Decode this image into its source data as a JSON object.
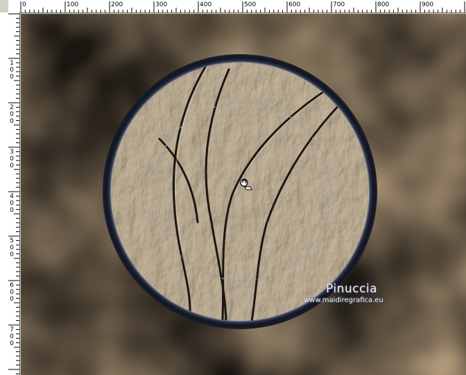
{
  "ruler": {
    "h_labels": [
      "0",
      "100",
      "200",
      "300",
      "400",
      "500",
      "600",
      "700",
      "800",
      "900"
    ],
    "v_labels": [
      "1\n0\n0",
      "2\n0\n0",
      "3\n0\n0",
      "4\n0\n0",
      "5\n0\n0",
      "6\n0\n0",
      "7\n0\n0"
    ]
  },
  "watermark": {
    "name": "Pinuccia",
    "site": "www.maidiregrafica.eu"
  },
  "colors": {
    "canvas_bg": "#9a8a72",
    "frame_ring": "#2a3040",
    "selection": "#7a9ab0"
  },
  "icons": {
    "cursor": "pick-tool-cursor-icon"
  }
}
